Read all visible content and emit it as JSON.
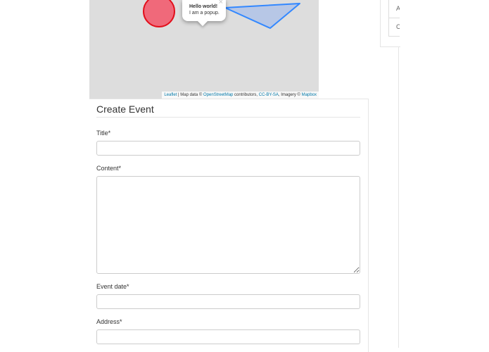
{
  "map": {
    "popup": {
      "close": "×",
      "title": "Hello world!",
      "text": "I am a popup."
    },
    "attribution": {
      "leaflet": "Leaflet",
      "map_data": " | Map data © ",
      "osm": "OpenStreetMap",
      "contributors": " contributors, ",
      "license": "CC-BY-SA",
      "imagery": ", Imagery © ",
      "mapbox": "Mapbox"
    },
    "colors": {
      "background": "#dddddd",
      "circle_stroke": "#e2101c",
      "circle_fill": "#f0697a",
      "polygon_stroke": "#3388ff",
      "polygon_fill": "#b7c7e6"
    }
  },
  "side": {
    "items": [
      "A",
      "C"
    ]
  },
  "form": {
    "title": "Create Event",
    "fields": {
      "title_label": "Title*",
      "title_value": "",
      "content_label": "Content*",
      "content_value": "",
      "date_label": "Event date*",
      "date_value": "",
      "address_label": "Address*",
      "address_value": ""
    }
  }
}
